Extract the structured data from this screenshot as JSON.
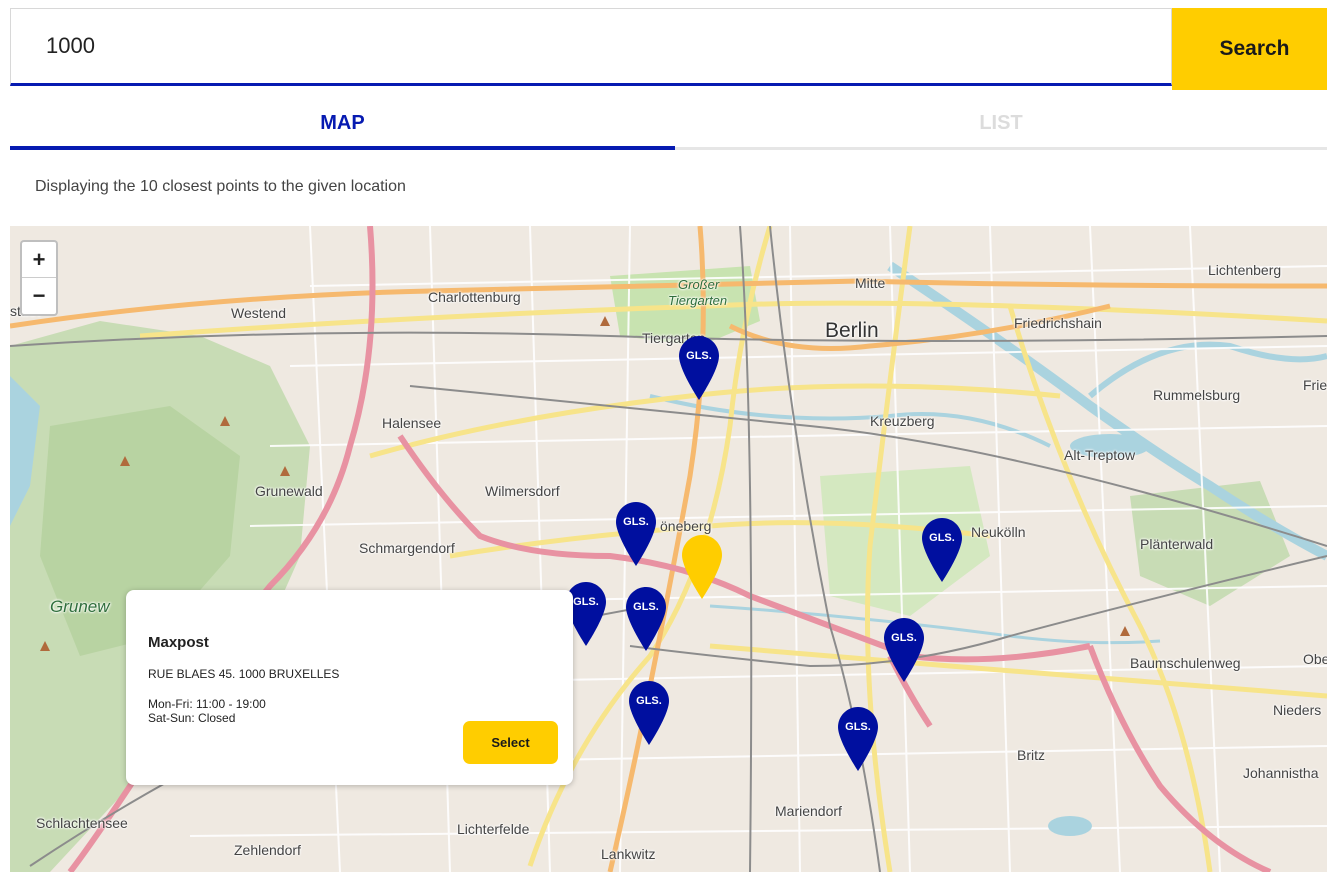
{
  "search": {
    "value": "1000",
    "button_label": "Search"
  },
  "tabs": [
    {
      "label": "MAP",
      "active": true
    },
    {
      "label": "LIST",
      "active": false
    }
  ],
  "info_text": "Displaying the 10 closest points to the given location",
  "map": {
    "zoom_in": "+",
    "zoom_out": "−",
    "labels": {
      "lichtenberg": "Lichtenberg",
      "charlottenburg": "Charlottenburg",
      "mitte": "Mitte",
      "westend": "Westend",
      "stadt": "stadt",
      "grosser": "Großer",
      "tiergarten_park": "Tiergarten",
      "friedrichshain": "Friedrichshain",
      "tiergarten": "Tiergarten",
      "berlin": "Berlin",
      "rummelsburg": "Rummelsburg",
      "frie": "Frie",
      "halensee": "Halensee",
      "kreuzberg": "Kreuzberg",
      "alt_treptow": "Alt-Treptow",
      "grunewald": "Grunewald",
      "wilmersdorf": "Wilmersdorf",
      "schoneberg": "öneberg",
      "neukolln": "Neukölln",
      "schmargendorf": "Schmargendorf",
      "planterwald": "Plänterwald",
      "grunewald_forest": "Grunew",
      "baumschulenweg": "Baumschulenweg",
      "obe": "Obe",
      "nieders": "Nieders",
      "britz": "Britz",
      "johannisth": "Johannistha",
      "mariendorf": "Mariendorf",
      "schlachtensee": "Schlachtensee",
      "lichterfelde": "Lichterfelde",
      "zehlendorf": "Zehlendorf",
      "lankwitz": "Lankwitz"
    },
    "pin_label": "GLS.",
    "pin_color": "#000f9f",
    "selected_pin_color": "#ffcd00"
  },
  "popup": {
    "title": "Maxpost",
    "address": "RUE BLAES 45. 1000 BRUXELLES",
    "hours_weekday": "Mon-Fri: 11:00 - 19:00",
    "hours_weekend": "Sat-Sun: Closed",
    "select_label": "Select"
  }
}
